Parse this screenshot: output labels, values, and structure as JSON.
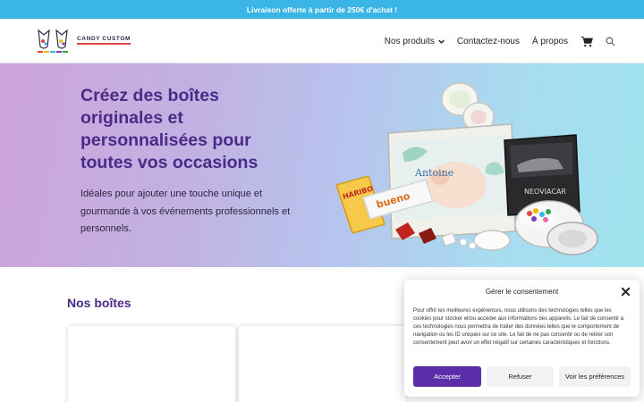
{
  "topbar": {
    "text": "Livraison offerte à partir de 250€ d'achat !"
  },
  "header": {
    "logo_text": "CANDY CUSTOM",
    "nav": {
      "products": "Nos produits",
      "contact": "Contactez-nous",
      "about": "À propos"
    },
    "icons": [
      "chevron-down-icon",
      "cart-icon",
      "search-icon"
    ]
  },
  "hero": {
    "title": "Créez des boîtes originales et personnalisées pour toutes vos occasions",
    "subtitle": "Idéales pour ajouter une touche unique et gourmande à vos événements professionnels et personnels.",
    "art": {
      "tin_name": "Antoine",
      "tin_brand": "NEOVIACAR",
      "candy_brand": "HARIBO",
      "bar_brand": "bueno"
    }
  },
  "section": {
    "title": "Nos boîtes"
  },
  "consent": {
    "title": "Gérer le consentement",
    "text": "Pour offrir les meilleures expériences, nous utilisons des technologies telles que les cookies pour stocker et/ou accéder aux informations des appareils. Le fait de consentir à ces technologies nous permettra de traiter des données telles que le comportement de navigation ou les ID uniques sur ce site. Le fait de ne pas consentir ou de retirer son consentement peut avoir un effet négatif sur certaines caractéristiques et fonctions.",
    "accept": "Accepter",
    "refuse": "Refuser",
    "preferences": "Voir les préférences"
  },
  "colors": {
    "topbar": "#3bb4e6",
    "accent": "#5c2da8",
    "heading": "#4a2b86"
  }
}
